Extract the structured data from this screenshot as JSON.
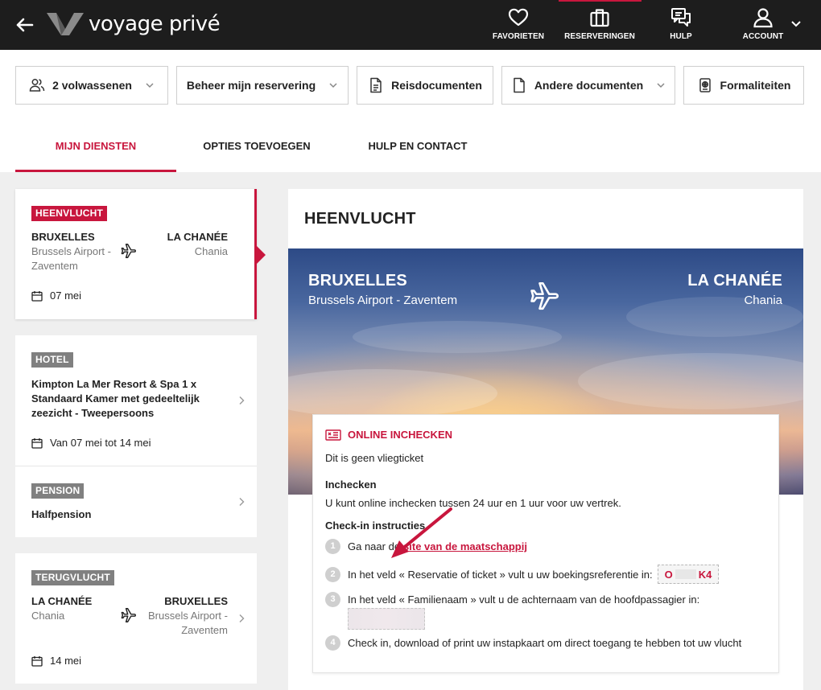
{
  "header": {
    "logo_text": "voyage privé",
    "nav": [
      {
        "label": "FAVORIETEN",
        "icon": "heart-icon"
      },
      {
        "label": "RESERVERINGEN",
        "icon": "suitcase-icon"
      },
      {
        "label": "HULP",
        "icon": "chat-icon"
      },
      {
        "label": "ACCOUNT",
        "icon": "user-icon"
      }
    ]
  },
  "actions": {
    "travelers": "2 volwassenen",
    "manage": "Beheer mijn reservering",
    "travel_docs": "Reisdocumenten",
    "other_docs": "Andere documenten",
    "formalities": "Formaliteiten"
  },
  "tabs": [
    {
      "label": "MIJN DIENSTEN",
      "active": true
    },
    {
      "label": "OPTIES TOEVOEGEN",
      "active": false
    },
    {
      "label": "HULP EN CONTACT",
      "active": false
    }
  ],
  "sidebar": {
    "outbound": {
      "badge": "HEENVLUCHT",
      "from_city": "BRUXELLES",
      "from_airport": "Brussels Airport - Zaventem",
      "to_city": "LA CHANÉE",
      "to_airport": "Chania",
      "date": "07 mei"
    },
    "hotel": {
      "badge": "HOTEL",
      "name": "Kimpton La Mer Resort & Spa 1 x Standaard Kamer met gedeeltelijk zeezicht - Tweepersoons",
      "date": "Van 07 mei tot 14 mei"
    },
    "board": {
      "badge": "PENSION",
      "name": "Halfpension"
    },
    "return": {
      "badge": "TERUGVLUCHT",
      "from_city": "LA CHANÉE",
      "from_airport": "Chania",
      "to_city": "BRUXELLES",
      "to_airport": "Brussels Airport - Zaventem",
      "date": "14 mei"
    }
  },
  "main": {
    "title": "HEENVLUCHT",
    "hero": {
      "from_city": "BRUXELLES",
      "from_airport": "Brussels Airport - Zaventem",
      "to_city": "LA CHANÉE",
      "to_airport": "Chania"
    },
    "checkin": {
      "title": "ONLINE INCHECKEN",
      "note": "Dit is geen vliegticket",
      "section1_title": "Inchecken",
      "section1_text": "U kunt online inchecken tussen 24 uur en 1 uur voor uw vertrek.",
      "section2_title": "Check-in instructies",
      "steps": [
        {
          "num": "1",
          "text": "Ga naar de",
          "link": "site van de maatschappij"
        },
        {
          "num": "2",
          "text": "In het veld « Reservatie of ticket » vult u uw boekingsreferentie in:"
        },
        {
          "num": "3",
          "text": "In het veld « Familienaam » vult u de achternaam van de hoofdpassagier in:"
        },
        {
          "num": "4",
          "text": "Check in, download of print uw instapkaart om direct toegang te hebben tot uw vlucht"
        }
      ],
      "ref_start": "O",
      "ref_end": "K4"
    }
  },
  "colors": {
    "accent": "#c8163d",
    "header_bg": "#1d1d1d",
    "badge_gray": "#808080"
  }
}
